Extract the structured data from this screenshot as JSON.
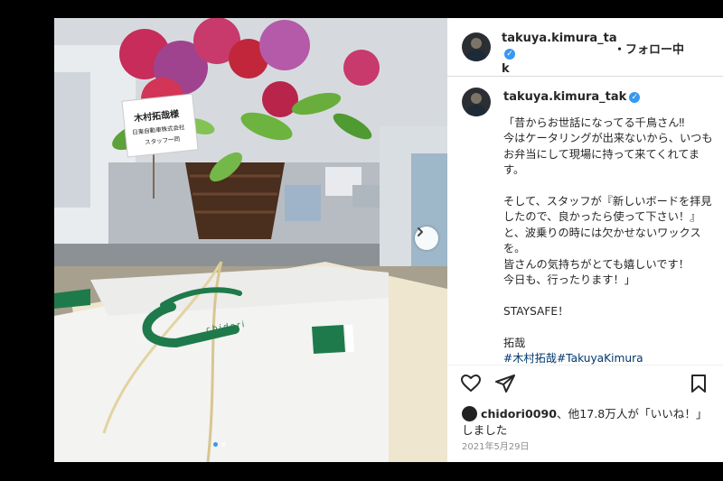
{
  "post": {
    "username": "takuya.kimura_tak",
    "username_wrapped_1": "takuya.kimura_ta",
    "username_wrapped_2": "k",
    "follow_label": "・フォロー中",
    "caption": "「昔からお世話になってる千鳥さん‼\n今はケータリングが出来ないから、いつもお弁当にして現場に持って来てくれてます。\n\nそして、スタッフが『新しいボードを拝見したので、良かったら使って下さい！』と、波乗りの時には欠かせないワックスを。\n皆さんの気持ちがとても嬉しいです！\n今日も、行ったります！」\n\nSTAYSAFE！\n\n拓哉",
    "hashtags": "#木村拓哉#TakuyaKimura",
    "likes_user": "chidori0090",
    "likes_text": "、他17.8万人が「いいね！」しました",
    "date": "2021年5月29日"
  },
  "photo": {
    "card_name": "木村拓哉様",
    "card_company": "日東自動車株式会社",
    "card_staff": "スタッフ一同",
    "box_logo": "chidori"
  },
  "icons": {
    "verified": "verified-badge-icon",
    "like": "heart-icon",
    "share": "paper-plane-icon",
    "save": "bookmark-icon",
    "next": "chevron-right-icon"
  },
  "colors": {
    "verified_blue": "#3897f0",
    "hashtag": "#00376b",
    "logo_green": "#1f7a4b"
  }
}
